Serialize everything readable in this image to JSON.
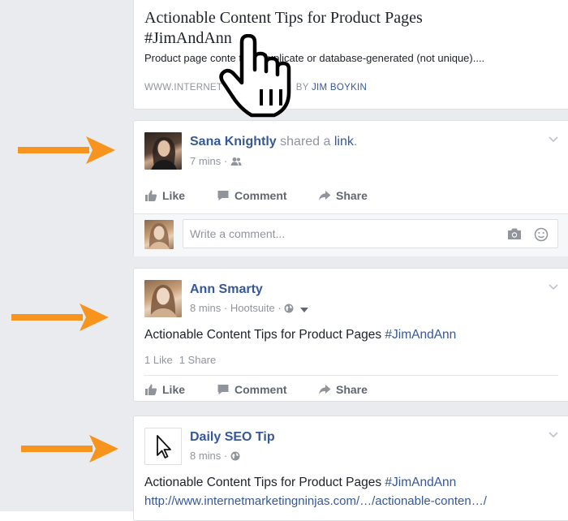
{
  "top_post": {
    "title": "Actionable Content Tips for Product Pages #JimAndAnn",
    "description": "Product page conte              thin, duplicate or database-generated (not unique)....",
    "source": "WWW.INTERNET              NINJAS.COM",
    "by_label": "BY",
    "author": "JIM BOYKIN"
  },
  "post1": {
    "author": "Sana Knightly",
    "verb": "shared a",
    "object": "link",
    "period": ".",
    "time": "7 mins",
    "sep": " · ",
    "audience_icon": "friends-icon",
    "actions": {
      "like": "Like",
      "comment": "Comment",
      "share": "Share"
    },
    "comment_placeholder": "Write a comment..."
  },
  "post2": {
    "author": "Ann Smarty",
    "time": "8 mins",
    "via": "Hootsuite",
    "sep": " · ",
    "audience_icon": "globe-icon",
    "text": "Actionable Content Tips for Product Pages ",
    "hashtag": "#JimAndAnn",
    "likes": "1 Like",
    "shares": "1 Share",
    "actions": {
      "like": "Like",
      "comment": "Comment",
      "share": "Share"
    }
  },
  "post3": {
    "author": "Daily SEO Tip",
    "time": "8 mins",
    "sep": " · ",
    "audience_icon": "globe-icon",
    "text": "Actionable Content Tips for Product Pages ",
    "hashtag": "#JimAndAnn",
    "link": "http://www.internetmarketingninjas.com/…/actionable-conten…/"
  },
  "colors": {
    "link_blue": "#365899",
    "meta_gray": "#90949c",
    "feed_bg": "#e9ebee",
    "arrow_orange": "#f7941d"
  }
}
